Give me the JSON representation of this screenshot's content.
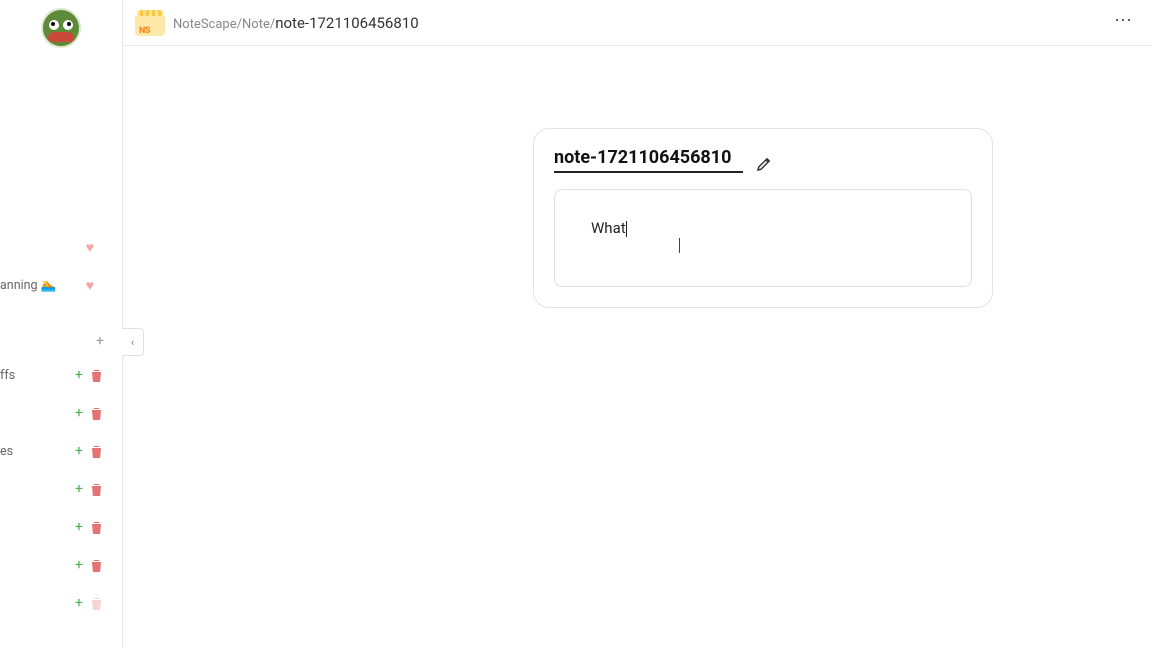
{
  "breadcrumb": {
    "root": "NoteScape",
    "mid": "Note",
    "current": "note-1721106456810"
  },
  "sidebar": {
    "favorites": [
      {
        "label": ""
      },
      {
        "label": "anning 🏊"
      }
    ],
    "notes": [
      {
        "label": "ffs"
      },
      {
        "label": ""
      },
      {
        "label": "es"
      },
      {
        "label": ""
      },
      {
        "label": ""
      },
      {
        "label": ""
      },
      {
        "label": ""
      }
    ]
  },
  "note": {
    "title": "note-1721106456810",
    "body": "What"
  },
  "icons": {
    "collapse": "‹",
    "more": "⋯",
    "plus": "+",
    "trash": "🗑",
    "heart": "♥"
  },
  "logo": {
    "text": "NS"
  }
}
